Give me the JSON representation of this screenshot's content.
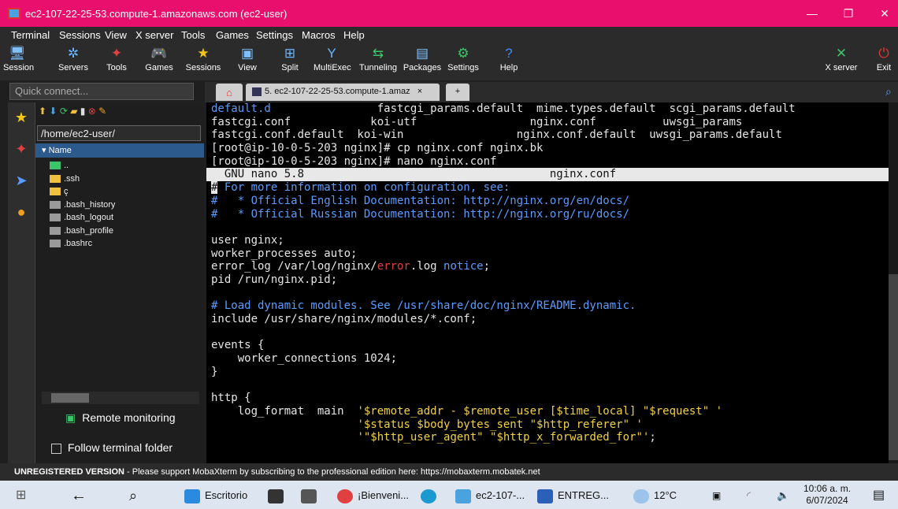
{
  "window": {
    "title": "ec2-107-22-25-53.compute-1.amazonaws.com (ec2-user)",
    "min": "—",
    "max": "❐",
    "close": "✕"
  },
  "menu": [
    "Terminal",
    "Sessions",
    "View",
    "X server",
    "Tools",
    "Games",
    "Settings",
    "Macros",
    "Help"
  ],
  "toolbar": [
    {
      "label": "Session",
      "icon": "session-icon",
      "glyph": "🖥",
      "color": "#7fc1ff"
    },
    {
      "label": "Servers",
      "icon": "servers-icon",
      "glyph": "✲",
      "color": "#6ab4ff"
    },
    {
      "label": "Tools",
      "icon": "tools-icon",
      "glyph": "✦",
      "color": "#e04040"
    },
    {
      "label": "Games",
      "icon": "games-icon",
      "glyph": "🎮",
      "color": "#ccc"
    },
    {
      "label": "Sessions",
      "icon": "star-icon",
      "glyph": "★",
      "color": "#f5c518"
    },
    {
      "label": "View",
      "icon": "view-icon",
      "glyph": "▣",
      "color": "#7fc1ff"
    },
    {
      "label": "Split",
      "icon": "split-icon",
      "glyph": "⊞",
      "color": "#6ab4ff"
    },
    {
      "label": "MultiExec",
      "icon": "multiexec-icon",
      "glyph": "Y",
      "color": "#6ab4ff"
    },
    {
      "label": "Tunneling",
      "icon": "tunneling-icon",
      "glyph": "⇆",
      "color": "#3cc46a"
    },
    {
      "label": "Packages",
      "icon": "packages-icon",
      "glyph": "▤",
      "color": "#7fc1ff"
    },
    {
      "label": "Settings",
      "icon": "settings-icon",
      "glyph": "⚙",
      "color": "#3cc46a"
    },
    {
      "label": "Help",
      "icon": "help-icon",
      "glyph": "?",
      "color": "#3a8cff"
    }
  ],
  "xserver": {
    "label": "X server",
    "exit": "Exit"
  },
  "quick_connect": {
    "placeholder": "Quick connect..."
  },
  "tab": {
    "label": "5.  ec2-107-22-25-53.compute-1.amaz",
    "close": "×",
    "new": "+"
  },
  "sftp": {
    "path": "/home/ec2-user/",
    "column": "Name",
    "files": [
      {
        "name": "..",
        "type": "up"
      },
      {
        "name": ".ssh",
        "type": "folder"
      },
      {
        "name": "ç",
        "type": "folder"
      },
      {
        "name": ".bash_history",
        "type": "file"
      },
      {
        "name": ".bash_logout",
        "type": "file"
      },
      {
        "name": ".bash_profile",
        "type": "file"
      },
      {
        "name": ".bashrc",
        "type": "file"
      }
    ],
    "remote_monitoring": "Remote monitoring",
    "follow": "Follow terminal folder"
  },
  "terminal": {
    "lines": [
      [
        [
          "default.d",
          "c-blue"
        ],
        [
          "                fastcgi_params.default  mime.types.default  scgi_params.default",
          ""
        ]
      ],
      [
        [
          "fastcgi.conf            koi-utf                 nginx.conf          uwsgi_params",
          ""
        ]
      ],
      [
        [
          "fastcgi.conf.default  koi-win                 nginx.conf.default  uwsgi_params.default",
          ""
        ]
      ],
      [
        [
          "[root@ip-10-0-5-203 nginx]# cp nginx.conf nginx.bk",
          ""
        ]
      ],
      [
        [
          "[root@ip-10-0-5-203 nginx]# nano nginx.conf",
          ""
        ]
      ],
      [
        [
          "  GNU nano 5.8                                     nginx.conf                                                  ",
          "hdr"
        ]
      ],
      [
        [
          "#",
          "hdrchar"
        ],
        [
          " For more information on configuration, see:",
          "c-blue"
        ]
      ],
      [
        [
          "#   * Official English Documentation: http://nginx.org/en/docs/",
          "c-blue"
        ]
      ],
      [
        [
          "#   * Official Russian Documentation: http://nginx.org/ru/docs/",
          "c-blue"
        ]
      ],
      [
        [
          "",
          ""
        ]
      ],
      [
        [
          "user nginx;",
          ""
        ]
      ],
      [
        [
          "worker_processes auto;",
          ""
        ]
      ],
      [
        [
          "error_log /var/log/nginx/",
          ""
        ],
        [
          "error",
          "c-red"
        ],
        [
          ".log ",
          ""
        ],
        [
          "notice",
          "c-blue"
        ],
        [
          ";",
          ""
        ]
      ],
      [
        [
          "pid /run/nginx.pid;",
          ""
        ]
      ],
      [
        [
          "",
          ""
        ]
      ],
      [
        [
          "# Load dynamic modules. See /usr/share/doc/nginx/README.dynamic.",
          "c-blue"
        ]
      ],
      [
        [
          "include /usr/share/nginx/modules/*.conf;",
          ""
        ]
      ],
      [
        [
          "",
          ""
        ]
      ],
      [
        [
          "events {",
          ""
        ]
      ],
      [
        [
          "    worker_connections 1024;",
          ""
        ]
      ],
      [
        [
          "}",
          ""
        ]
      ],
      [
        [
          "",
          ""
        ]
      ],
      [
        [
          "http {",
          ""
        ]
      ],
      [
        [
          "    log_format  main  ",
          ""
        ],
        [
          "'$remote_addr - $remote_user [$time_local] \"$request\" '",
          "c-yel"
        ]
      ],
      [
        [
          "                      ",
          ""
        ],
        [
          "'$status $body_bytes_sent \"$http_referer\" '",
          "c-yel"
        ]
      ],
      [
        [
          "                      ",
          ""
        ],
        [
          "'\"$http_user_agent\" \"$http_x_forwarded_for\"'",
          "c-yel"
        ],
        [
          ";",
          ""
        ]
      ]
    ]
  },
  "status": {
    "bold": "UNREGISTERED VERSION",
    "text": "  -  Please support MobaXterm by subscribing to the professional edition here:  ",
    "link": "https://mobaxterm.mobatek.net"
  },
  "taskbar": {
    "escritorio": "Escritorio",
    "chrome": "¡Bienveni...",
    "moba": "ec2-107-...",
    "word": "ENTREG...",
    "weather": "12°C",
    "time": "10:06 a. m.",
    "date": "6/07/2024"
  }
}
